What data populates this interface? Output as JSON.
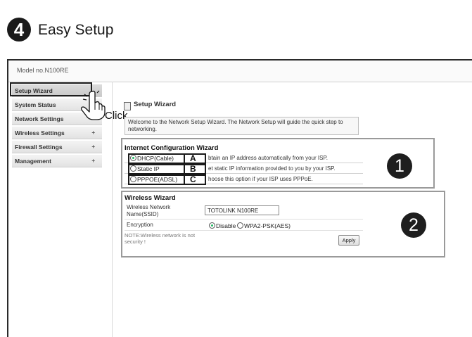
{
  "step": {
    "number": "4",
    "title": "Easy Setup"
  },
  "router": {
    "model_label": "Model no.N100RE"
  },
  "sidebar": {
    "items": [
      {
        "label": "Setup Wizard",
        "expander": ""
      },
      {
        "label": "System Status",
        "expander": ""
      },
      {
        "label": "Network Settings",
        "expander": "+"
      },
      {
        "label": "Wireless Settings",
        "expander": "+"
      },
      {
        "label": "Firewall Settings",
        "expander": "+"
      },
      {
        "label": "Management",
        "expander": "+"
      }
    ]
  },
  "annotation": {
    "click_label": "Click",
    "hand_icon": "hand-pointer-icon"
  },
  "content": {
    "title": "Setup Wizard",
    "welcome_text": "Welcome to the Network Setup Wizard. The Network Setup will guide the quick step to networking."
  },
  "internet_wizard": {
    "title": "Internet Configuration Wizard",
    "callout_number": "1",
    "options": [
      {
        "label": "DHCP(Cable)",
        "letter": "A",
        "description": "btain an IP address automatically from your ISP.",
        "selected": true
      },
      {
        "label": "Static IP",
        "letter": "B",
        "description": "et static IP information provided to you by your ISP.",
        "selected": false
      },
      {
        "label": "PPPOE(ADSL)",
        "letter": "C",
        "description": "hoose this option if your ISP uses PPPoE.",
        "selected": false
      }
    ]
  },
  "wireless_wizard": {
    "title": "Wireless Wizard",
    "callout_number": "2",
    "ssid_label": "Wireless Network Name(SSID)",
    "ssid_value": "TOTOLINK N100RE",
    "encryption_label": "Encryption",
    "encryption_options": [
      {
        "label": "Disable",
        "selected": true
      },
      {
        "label": "WPA2-PSK(AES)",
        "selected": false
      }
    ],
    "note": "NOTE:Wireless network is not security !",
    "apply_label": "Apply"
  },
  "colors": {
    "callout": "#1e1e1e",
    "highlight_border": "#9a9a9a",
    "active_border": "#1e1e1e"
  }
}
